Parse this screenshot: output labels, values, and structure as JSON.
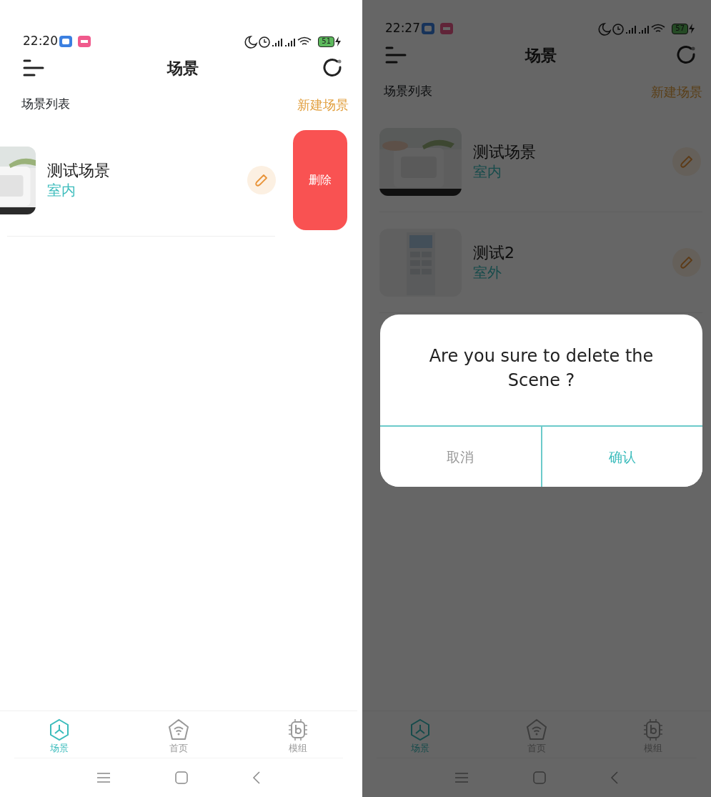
{
  "screens": [
    {
      "status_bar": {
        "time": "22:20",
        "battery": "51"
      },
      "title": "场景",
      "section_label": "场景列表",
      "new_scene": "新建场景",
      "scenes": [
        {
          "name": "测试场景",
          "location": "室内",
          "swiped": true,
          "delete_label": "删除"
        }
      ],
      "tabs": [
        {
          "label": "场景",
          "selected": true
        },
        {
          "label": "首页",
          "selected": false
        },
        {
          "label": "模组",
          "selected": false
        }
      ]
    },
    {
      "status_bar": {
        "time": "22:27",
        "battery": "57"
      },
      "title": "场景",
      "section_label": "场景列表",
      "new_scene": "新建场景",
      "scenes": [
        {
          "name": "测试场景",
          "location": "室内",
          "swiped": false
        },
        {
          "name": "测试2",
          "location": "室外",
          "swiped": false
        }
      ],
      "tabs": [
        {
          "label": "场景",
          "selected": true
        },
        {
          "label": "首页",
          "selected": false
        },
        {
          "label": "模组",
          "selected": false
        }
      ],
      "dialog": {
        "message": "Are you sure to delete the Scene ?",
        "cancel": "取消",
        "confirm": "确认"
      }
    }
  ]
}
